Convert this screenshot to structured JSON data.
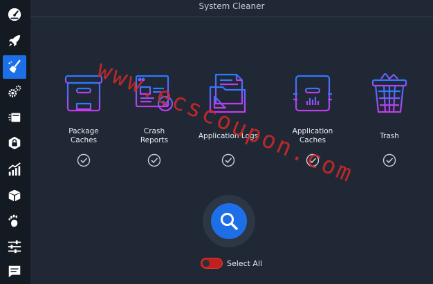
{
  "window": {
    "title": "System Cleaner"
  },
  "sidebar": {
    "items": [
      {
        "icon": "speedometer-icon"
      },
      {
        "icon": "rocket-icon"
      },
      {
        "icon": "broom-icon",
        "active": true
      },
      {
        "icon": "gears-icon"
      },
      {
        "icon": "card-stack-icon"
      },
      {
        "icon": "package-lock-icon"
      },
      {
        "icon": "bar-chart-icon"
      },
      {
        "icon": "cube-icon"
      },
      {
        "icon": "gnome-foot-icon"
      },
      {
        "icon": "sliders-icon"
      },
      {
        "icon": "message-icon"
      }
    ]
  },
  "cleaner": {
    "items": [
      {
        "label": "Package\nCaches",
        "icon": "package-box-icon",
        "checked": true
      },
      {
        "label": "Crash\nReports",
        "icon": "crash-report-icon",
        "checked": true
      },
      {
        "label": "Application Logs",
        "icon": "folder-logs-icon",
        "checked": true
      },
      {
        "label": "Application\nCaches",
        "icon": "app-cache-box-icon",
        "checked": true
      },
      {
        "label": "Trash",
        "icon": "trash-basket-icon",
        "checked": true
      }
    ],
    "scan_icon": "search-icon",
    "select_all": {
      "label": "Select All",
      "on": false
    }
  },
  "colors": {
    "accent": "#1d6fe8",
    "background": "#1f2834",
    "sidebar": "#141a22",
    "toggle_off": "#c21f1f",
    "gradient_start": "#2a7bff",
    "gradient_end": "#c43bf0"
  },
  "watermark": {
    "text": "www.ecscoupon.com"
  }
}
